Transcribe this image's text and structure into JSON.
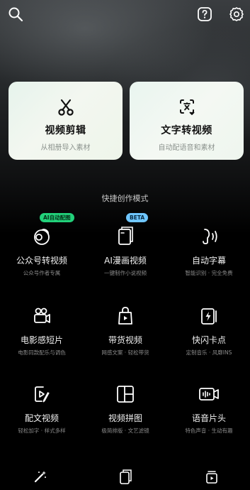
{
  "colors": {
    "accent_green": "#22d17a",
    "accent_blue": "#6fc6ff",
    "background": "#000000"
  },
  "topbar": {
    "left_icon": "search-icon",
    "right_icons": [
      "help-icon",
      "settings-icon"
    ]
  },
  "cards": [
    {
      "title": "视频剪辑",
      "subtitle": "从相册导入素材",
      "icon": "scissors-icon"
    },
    {
      "title": "文字转视频",
      "subtitle": "自动配语音和素材",
      "icon": "text-to-video-icon"
    }
  ],
  "section_title": "快捷创作模式",
  "modes": [
    {
      "title": "公众号转视频",
      "subtitle": "公众号作者专属",
      "icon": "article-to-video-icon",
      "badge": "AI自动配图"
    },
    {
      "title": "AI漫画视频",
      "subtitle": "一键制作小说视频",
      "icon": "comic-book-icon",
      "badge": "BETA"
    },
    {
      "title": "自动字幕",
      "subtitle": "智能识别 · 完全免费",
      "icon": "auto-subtitle-icon"
    },
    {
      "title": "电影感短片",
      "subtitle": "电影同款配乐与调色",
      "icon": "movie-camera-icon"
    },
    {
      "title": "带货视频",
      "subtitle": "网感文案 · 轻松带货",
      "icon": "shopping-bag-icon"
    },
    {
      "title": "快闪卡点",
      "subtitle": "定制音乐 · 风靡INS",
      "icon": "flash-card-icon"
    },
    {
      "title": "配文视频",
      "subtitle": "轻松加字 · 样式多样",
      "icon": "text-video-icon"
    },
    {
      "title": "视频拼图",
      "subtitle": "极简排版 · 文艺滤镜",
      "icon": "collage-grid-icon"
    },
    {
      "title": "语音片头",
      "subtitle": "特色声音 · 生动有趣",
      "icon": "voice-intro-icon"
    }
  ],
  "bottom_nav": [
    "magic-wand-icon",
    "templates-icon",
    "drafts-icon"
  ]
}
